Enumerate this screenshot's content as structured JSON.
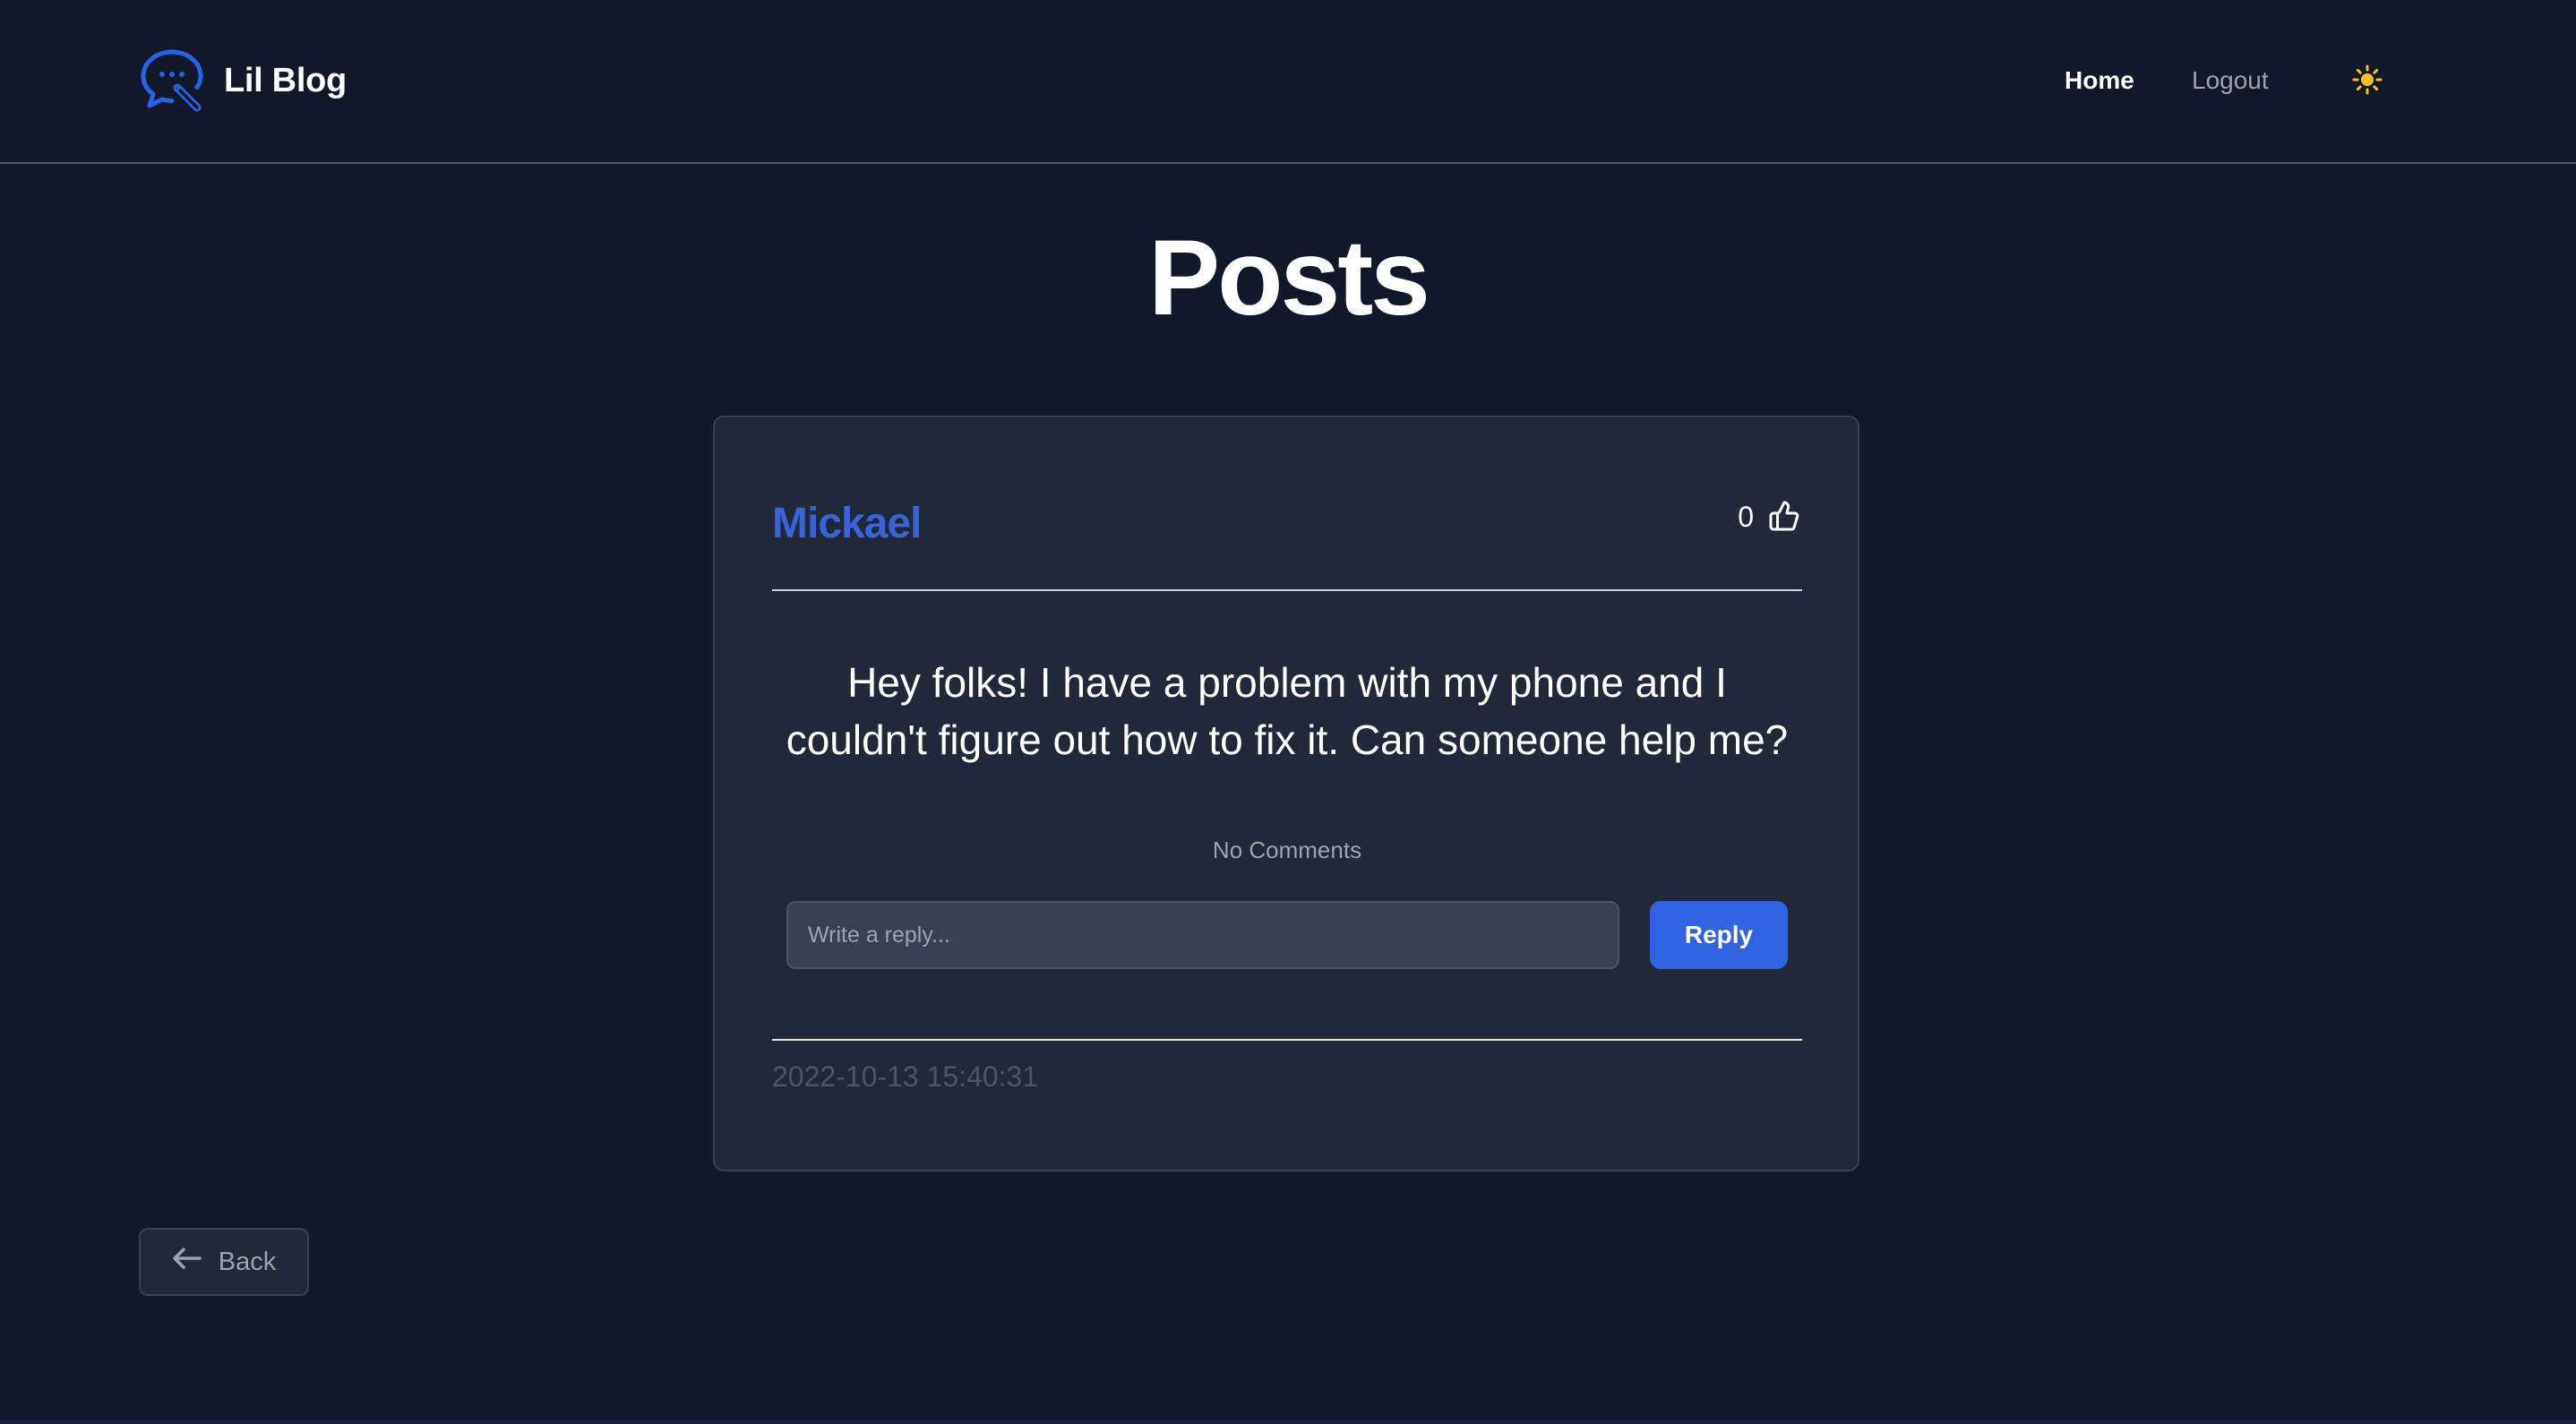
{
  "header": {
    "brand_title": "Lil Blog",
    "logo_icon": "chat-bubble-pen-icon",
    "nav": {
      "home_label": "Home",
      "logout_label": "Logout"
    },
    "theme_toggle_icon": "sun-icon"
  },
  "main": {
    "page_title": "Posts",
    "post": {
      "author": "Mickael",
      "likes": "0",
      "like_icon": "thumbs-up-icon",
      "body": "Hey folks! I have a problem with my phone and I couldn't figure out how to fix it. Can someone help me?",
      "comments_status": "No Comments",
      "reply_placeholder": "Write a reply...",
      "reply_value": "",
      "reply_button_label": "Reply",
      "timestamp": "2022-10-13 15:40:31"
    },
    "back_button_label": "Back",
    "back_icon": "arrow-left-icon"
  },
  "colors": {
    "background": "#111827",
    "card": "#1f2937",
    "accent": "#2f63e0",
    "author": "#3b63d9",
    "sun": "#fbbf24"
  }
}
